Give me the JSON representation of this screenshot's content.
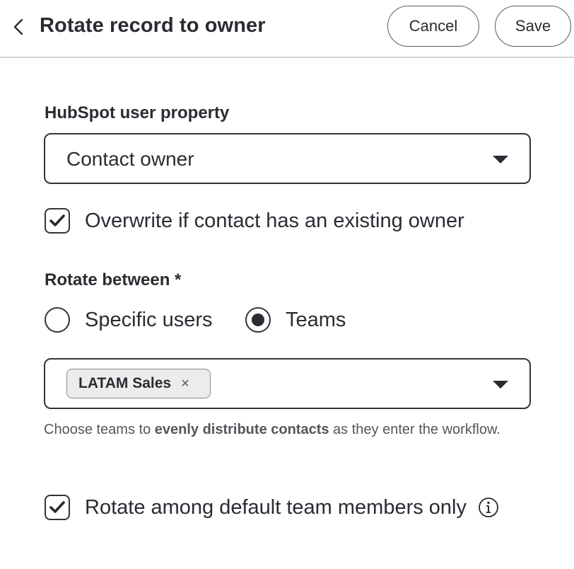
{
  "header": {
    "title": "Rotate record to owner",
    "back_icon": "chevron-left-icon",
    "cancel_label": "Cancel",
    "save_label": "Save"
  },
  "user_property": {
    "label": "HubSpot user property",
    "selected": "Contact owner",
    "caret_icon": "caret-down-icon"
  },
  "overwrite_checkbox": {
    "label": "Overwrite if contact has an existing owner",
    "checked": true
  },
  "rotate_between": {
    "label": "Rotate between *",
    "options": [
      {
        "label": "Specific users",
        "selected": false
      },
      {
        "label": "Teams",
        "selected": true
      }
    ]
  },
  "teams_select": {
    "tags": [
      {
        "label": "LATAM Sales",
        "remove_icon": "×"
      }
    ],
    "caret_icon": "caret-down-icon"
  },
  "help_text": {
    "prefix": "Choose teams to ",
    "emphasis": "evenly distribute contacts",
    "suffix": " as they enter the workflow."
  },
  "default_members_checkbox": {
    "label": "Rotate among default team members only",
    "checked": true,
    "info_icon": "info-icon"
  },
  "colors": {
    "text": "#2b2b33",
    "border": "#33333a",
    "divider": "#d6d6d6",
    "tag_bg": "#ececec"
  }
}
